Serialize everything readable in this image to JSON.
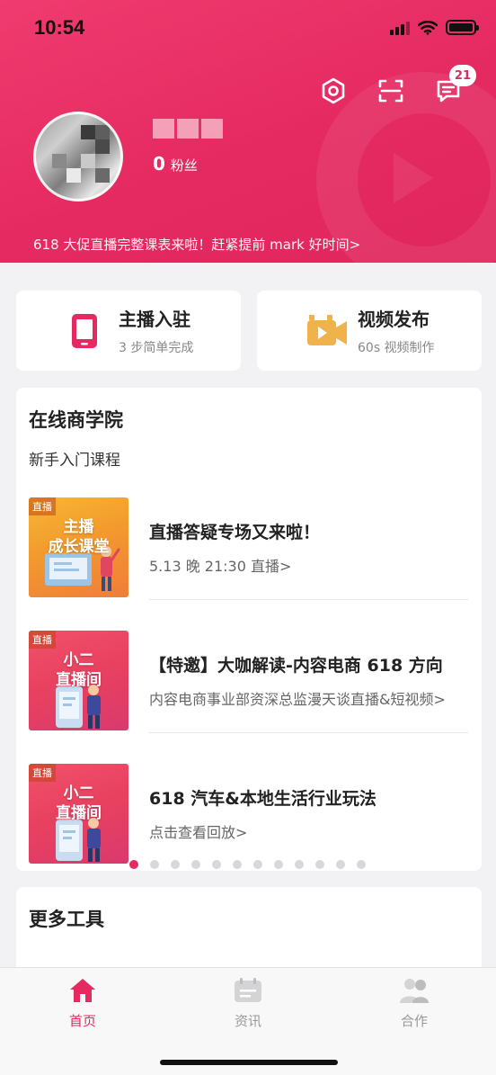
{
  "status_bar": {
    "time": "10:54"
  },
  "header": {
    "message_badge": "21",
    "fans_count": "0",
    "fans_label": "粉丝",
    "notice": "618 大促直播完整课表来啦！赶紧提前 mark 好时间>"
  },
  "quick_actions": [
    {
      "title": "主播入驻",
      "subtitle": "3 步简单完成",
      "icon": "phone-icon"
    },
    {
      "title": "视频发布",
      "subtitle": "60s 视频制作",
      "icon": "video-camera-icon"
    }
  ],
  "academy": {
    "title": "在线商学院",
    "subtitle": "新手入门课程",
    "courses": [
      {
        "tag": "直播",
        "thumb_line1": "主播",
        "thumb_line2": "成长课堂",
        "title": "直播答疑专场又来啦！",
        "desc": "5.13 晚 21:30 直播>"
      },
      {
        "tag": "直播",
        "thumb_line1": "小二",
        "thumb_line2": "直播间",
        "title": "【特邀】大咖解读-内容电商 618 方向",
        "desc": "内容电商事业部资深总监漫天谈直播&短视频>"
      },
      {
        "tag": "直播",
        "thumb_line1": "小二",
        "thumb_line2": "直播间",
        "title": "618 汽车&本地生活行业玩法",
        "desc": "点击查看回放>"
      }
    ],
    "pagination": {
      "total": 12,
      "active": 1
    }
  },
  "more_tools": {
    "title": "更多工具"
  },
  "tabbar": {
    "tabs": [
      {
        "label": "首页",
        "icon": "home-icon",
        "active": true
      },
      {
        "label": "资讯",
        "icon": "news-icon",
        "active": false
      },
      {
        "label": "合作",
        "icon": "users-icon",
        "active": false
      }
    ]
  },
  "colors": {
    "brand": "#e52a61",
    "thumb_orange": "#f29a2e",
    "thumb_pink": "#e8405f"
  }
}
